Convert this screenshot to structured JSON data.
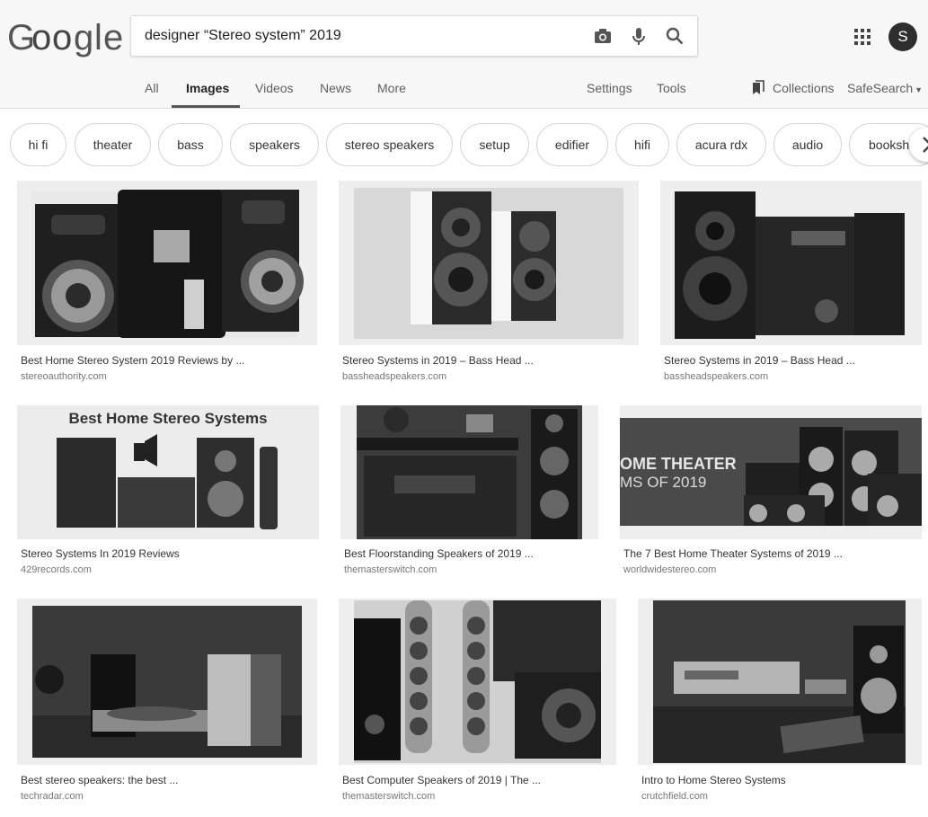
{
  "search": {
    "query": "designer “Stereo system” 2019"
  },
  "header": {
    "logo_letters": [
      "G",
      "o",
      "o",
      "g",
      "l",
      "e"
    ],
    "avatar_letter": "S"
  },
  "tabs": [
    {
      "label": "All"
    },
    {
      "label": "Images"
    },
    {
      "label": "Videos"
    },
    {
      "label": "News"
    },
    {
      "label": "More"
    }
  ],
  "tools": {
    "settings": "Settings",
    "tools": "Tools",
    "collections": "Collections",
    "safesearch": "SafeSearch"
  },
  "chips": [
    "hi fi",
    "theater",
    "bass",
    "speakers",
    "stereo speakers",
    "setup",
    "edifier",
    "hifi",
    "acura rdx",
    "audio",
    "bookshelf"
  ],
  "results": [
    {
      "title": "Best Home Stereo System 2019 Reviews by ...",
      "domain": "stereoauthority.com"
    },
    {
      "title": "Stereo Systems in 2019 – Bass Head ...",
      "domain": "bassheadspeakers.com"
    },
    {
      "title": "Stereo Systems in 2019 – Bass Head ...",
      "domain": "bassheadspeakers.com"
    },
    {
      "title": "Stereo Systems In 2019 Reviews",
      "domain": "429records.com",
      "image_text": "Best Home Stereo Systems"
    },
    {
      "title": "Best Floorstanding Speakers of 2019 ...",
      "domain": "themasterswitch.com"
    },
    {
      "title": "The 7 Best Home Theater Systems of 2019 ...",
      "domain": "worldwidestereo.com",
      "image_text_line1": "OME THEATER",
      "image_text_line2": "MS OF 2019"
    },
    {
      "title": "Best stereo speakers: the best ...",
      "domain": "techradar.com"
    },
    {
      "title": "Best Computer Speakers of 2019 | The ...",
      "domain": "themasterswitch.com"
    },
    {
      "title": "Intro to Home Stereo Systems",
      "domain": "crutchfield.com"
    }
  ],
  "colors": {
    "header_bg": "#f7f7f7",
    "active_tab": "#222222",
    "inactive_tab": "#5f5f5f",
    "domain_text": "#777777"
  },
  "icons": [
    "camera-icon",
    "microphone-icon",
    "search-icon",
    "apps-grid-icon",
    "collections-bookmark-icon",
    "chevron-right-icon",
    "caret-down-icon"
  ]
}
